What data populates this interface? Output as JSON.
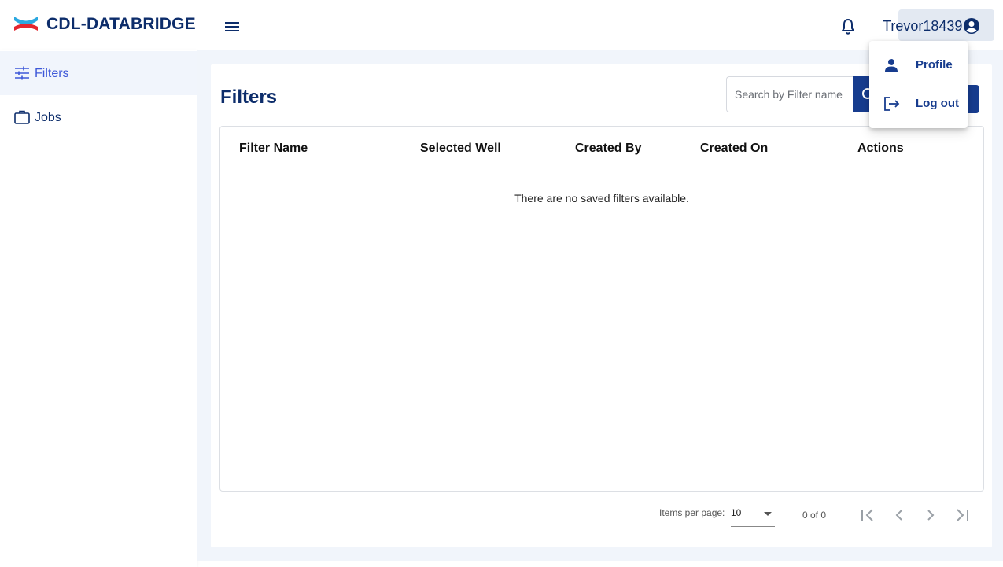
{
  "header": {
    "brand": "CDL-DATABRIDGE",
    "user_name": "Trevor18439",
    "icons": [
      "logo-icon",
      "menu-icon",
      "bell-icon",
      "account-circle-icon"
    ]
  },
  "sidebar": {
    "items": [
      {
        "label": "Filters",
        "icon": "tune-icon",
        "active": true
      },
      {
        "label": "Jobs",
        "icon": "briefcase-icon",
        "active": false
      }
    ]
  },
  "main": {
    "title": "Filters",
    "search": {
      "placeholder": "Search by Filter name",
      "value": ""
    },
    "table": {
      "columns": [
        "Filter Name",
        "Selected Well",
        "Created By",
        "Created On",
        "Actions"
      ],
      "rows": [],
      "empty_message": "There are no saved filters available."
    },
    "paginator": {
      "items_per_page_label": "Items per page:",
      "items_per_page": "10",
      "range": "0 of 0"
    }
  },
  "user_menu": {
    "items": [
      {
        "label": "Profile",
        "icon": "person-icon"
      },
      {
        "label": "Log out",
        "icon": "logout-icon"
      }
    ]
  },
  "colors": {
    "brand_navy": "#0d2d6b",
    "primary_button": "#173c8e",
    "active_nav": "#3e58d8",
    "content_background": "#f1f5fb",
    "logo_blue": "#2ba8e0",
    "logo_red": "#e4262f"
  }
}
